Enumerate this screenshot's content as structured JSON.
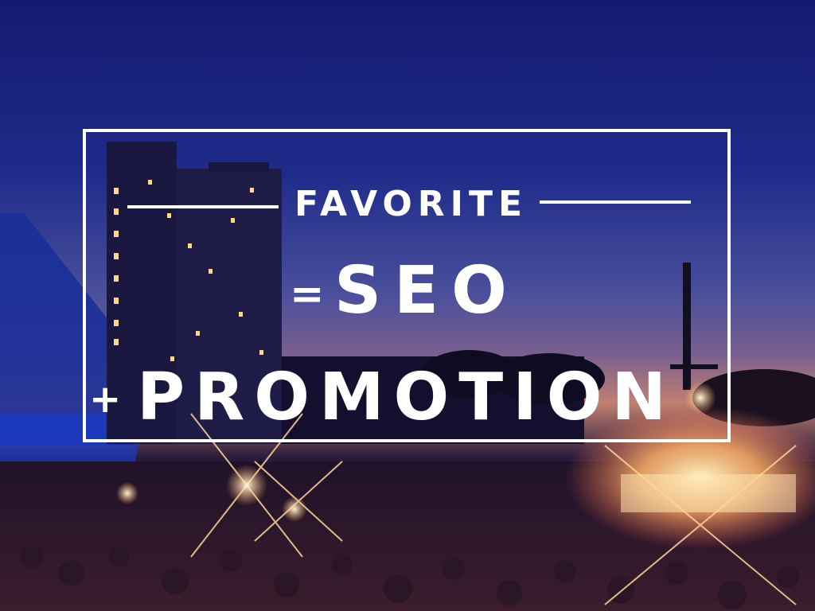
{
  "poster": {
    "word_favorite": "FAVORITE",
    "word_equals": "=",
    "word_seo": "SEO",
    "word_plus": "+",
    "word_promotion": "PROMOTION"
  },
  "colors": {
    "text": "#ffffff",
    "frame": "#ffffff",
    "sky_top": "#141a6e",
    "sunset_glow": "#ffc27a"
  }
}
